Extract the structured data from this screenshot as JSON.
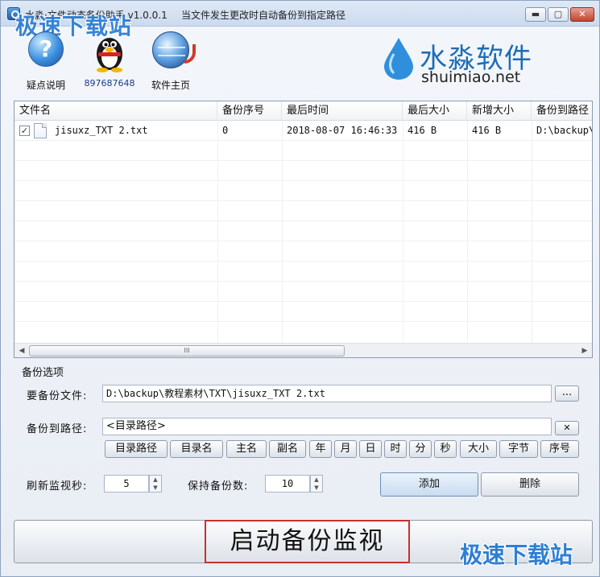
{
  "window": {
    "title": "水淼·文件动态备份助手 v1.0.0.1",
    "subtitle": "当文件发生更改时自动备份到指定路径",
    "controls": {
      "minimize": "▬",
      "maximize": "▢",
      "close": "✕"
    }
  },
  "watermark": {
    "top_left": "极速下载站",
    "bottom_right": "极速下载站"
  },
  "toolbar": {
    "help_label": "疑点说明",
    "qq_label": "897687648",
    "home_label": "软件主页"
  },
  "brand": {
    "cn": "水淼软件",
    "en": "shuimiao.net"
  },
  "table": {
    "columns": [
      "文件名",
      "备份序号",
      "最后时间",
      "最后大小",
      "新增大小",
      "备份到路径"
    ],
    "rows": [
      {
        "checked": "✓",
        "filename": "jisuxz_TXT 2.txt",
        "seq": "0",
        "last_time": "2018-08-07 16:46:33",
        "last_size": "416 B",
        "added_size": "416 B",
        "path": "D:\\backup\\"
      }
    ],
    "scroll": {
      "left": "◀",
      "right": "▶",
      "thumb": "III"
    }
  },
  "options": {
    "group_title": "备份选项",
    "file_label": "要备份文件:",
    "file_value": "D:\\backup\\教程素材\\TXT\\jisuxz_TXT 2.txt",
    "browse_label": "...",
    "path_label": "备份到路径:",
    "path_value": "<目录路径>",
    "clear_label": "✕",
    "tokens": [
      "目录路径",
      "目录名",
      "主名",
      "副名",
      "年",
      "月",
      "日",
      "时",
      "分",
      "秒",
      "大小",
      "字节",
      "序号"
    ],
    "refresh_label": "刷新监视秒:",
    "refresh_value": "5",
    "keep_label": "保持备份数:",
    "keep_value": "10",
    "spin_up": "▲",
    "spin_down": "▼",
    "add_label": "添加",
    "delete_label": "删除"
  },
  "start_button": {
    "label": "启动备份监视"
  }
}
